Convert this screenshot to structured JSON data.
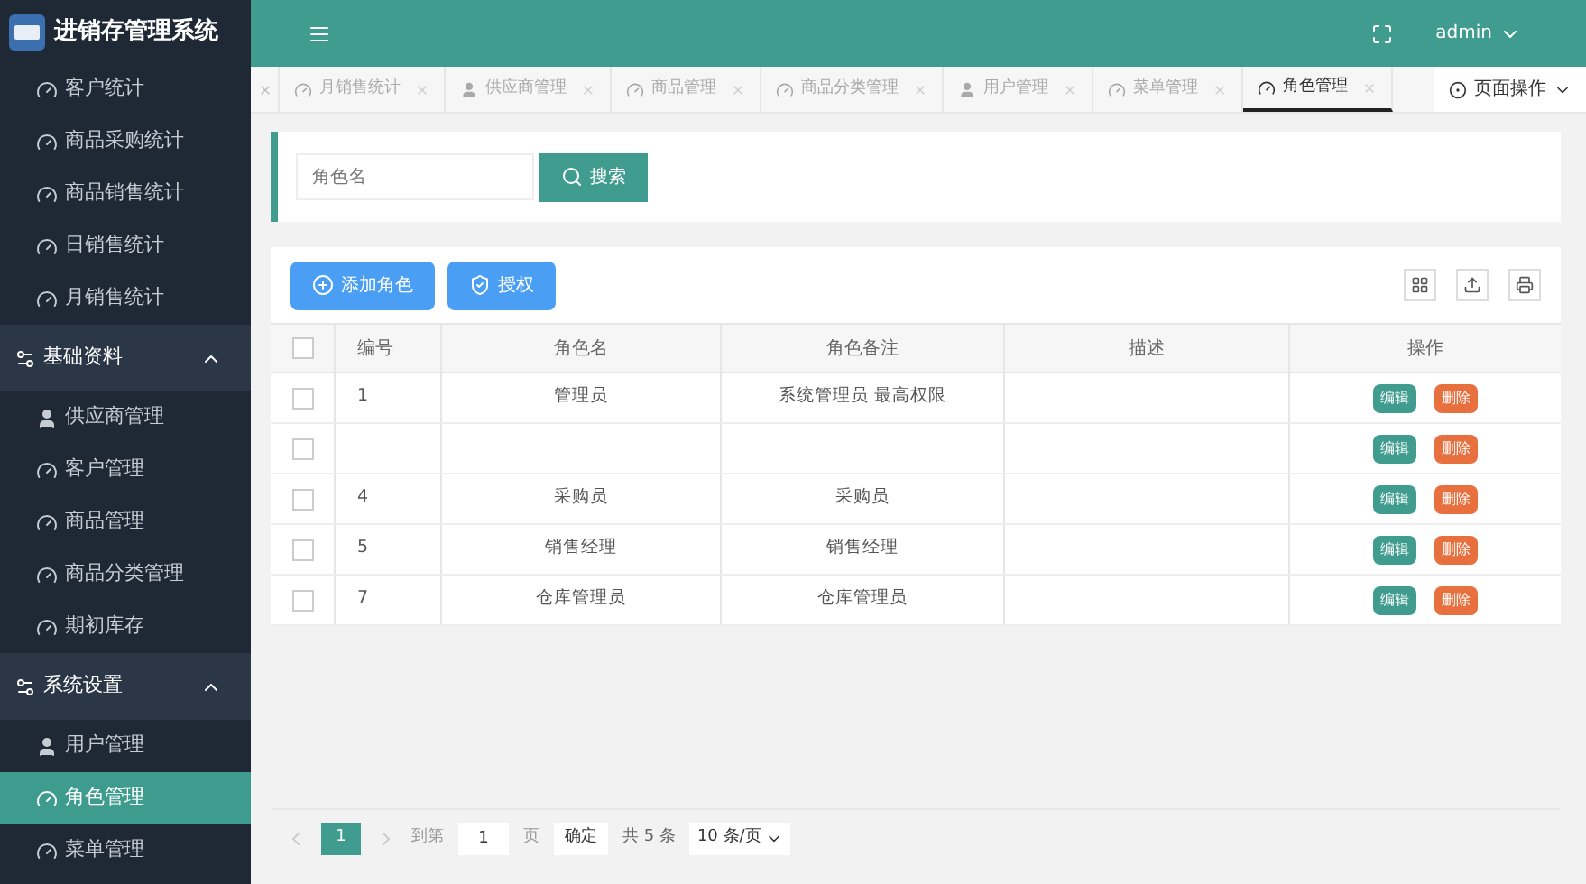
{
  "app_title": "进销存管理系统",
  "user_menu": "admin",
  "sidebar": {
    "items": [
      {
        "kind": "page",
        "label": "客户统计",
        "selected": false
      },
      {
        "kind": "page",
        "label": "商品采购统计",
        "selected": false
      },
      {
        "kind": "page",
        "label": "商品销售统计",
        "selected": false
      },
      {
        "kind": "page",
        "label": "日销售统计",
        "selected": false
      },
      {
        "kind": "page",
        "label": "月销售统计",
        "selected": false
      },
      {
        "kind": "group",
        "label": "基础资料",
        "expanded": true,
        "children": [
          {
            "kind": "person_page",
            "label": "供应商管理",
            "selected": false
          },
          {
            "kind": "page",
            "label": "客户管理",
            "selected": false
          },
          {
            "kind": "page",
            "label": "商品管理",
            "selected": false
          },
          {
            "kind": "page",
            "label": "商品分类管理",
            "selected": false
          },
          {
            "kind": "page",
            "label": "期初库存",
            "selected": false
          }
        ]
      },
      {
        "kind": "group",
        "label": "系统设置",
        "expanded": true,
        "children": [
          {
            "kind": "person_page",
            "label": "用户管理",
            "selected": false
          },
          {
            "kind": "page",
            "label": "角色管理",
            "selected": true
          },
          {
            "kind": "page",
            "label": "菜单管理",
            "selected": false
          }
        ]
      }
    ]
  },
  "tabs": [
    {
      "kind": "page",
      "label": "月销售统计",
      "selected": false
    },
    {
      "kind": "person_page",
      "label": "供应商管理",
      "selected": false
    },
    {
      "kind": "page",
      "label": "商品管理",
      "selected": false
    },
    {
      "kind": "page",
      "label": "商品分类管理",
      "selected": false
    },
    {
      "kind": "person_page",
      "label": "用户管理",
      "selected": false
    },
    {
      "kind": "page",
      "label": "菜单管理",
      "selected": false
    },
    {
      "kind": "page",
      "label": "角色管理",
      "selected": true
    }
  ],
  "page_actions": "页面操作",
  "search": {
    "placeholder": "角色名",
    "button": "搜索"
  },
  "toolbar": {
    "add": "添加角色",
    "grant": "授权"
  },
  "table": {
    "select_all_checked": false,
    "columns": [
      "编号",
      "角色名",
      "角色备注",
      "描述",
      "操作"
    ],
    "rows": [
      {
        "id": "1",
        "name": "管理员",
        "note": "系统管理员 最高权限",
        "checked": false,
        "edit": "编辑",
        "delete": "删除"
      },
      {
        "checked": false,
        "edit": "编辑",
        "delete": "删除"
      },
      {
        "id": "4",
        "name": "采购员",
        "note": "采购员",
        "checked": false,
        "edit": "编辑",
        "delete": "删除"
      },
      {
        "id": "5",
        "name": "销售经理",
        "note": "销售经理",
        "checked": false,
        "edit": "编辑",
        "delete": "删除"
      },
      {
        "id": "7",
        "name": "仓库管理员",
        "note": "仓库管理员",
        "checked": false,
        "edit": "编辑",
        "delete": "删除"
      }
    ]
  },
  "pagination": {
    "pages": [
      {
        "label": "1",
        "selected": true
      }
    ],
    "goto": "到第",
    "page_value": "1",
    "page_unit": "页",
    "confirm": "确定",
    "total": "共 5 条",
    "page_size": "10 条/页"
  }
}
